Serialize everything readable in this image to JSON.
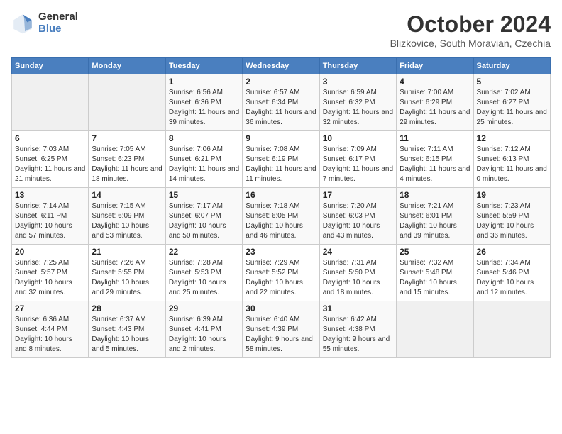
{
  "header": {
    "logo_general": "General",
    "logo_blue": "Blue",
    "month_title": "October 2024",
    "location": "Blizkovice, South Moravian, Czechia"
  },
  "days_of_week": [
    "Sunday",
    "Monday",
    "Tuesday",
    "Wednesday",
    "Thursday",
    "Friday",
    "Saturday"
  ],
  "weeks": [
    [
      {
        "day": "",
        "info": ""
      },
      {
        "day": "",
        "info": ""
      },
      {
        "day": "1",
        "info": "Sunrise: 6:56 AM\nSunset: 6:36 PM\nDaylight: 11 hours and 39 minutes."
      },
      {
        "day": "2",
        "info": "Sunrise: 6:57 AM\nSunset: 6:34 PM\nDaylight: 11 hours and 36 minutes."
      },
      {
        "day": "3",
        "info": "Sunrise: 6:59 AM\nSunset: 6:32 PM\nDaylight: 11 hours and 32 minutes."
      },
      {
        "day": "4",
        "info": "Sunrise: 7:00 AM\nSunset: 6:29 PM\nDaylight: 11 hours and 29 minutes."
      },
      {
        "day": "5",
        "info": "Sunrise: 7:02 AM\nSunset: 6:27 PM\nDaylight: 11 hours and 25 minutes."
      }
    ],
    [
      {
        "day": "6",
        "info": "Sunrise: 7:03 AM\nSunset: 6:25 PM\nDaylight: 11 hours and 21 minutes."
      },
      {
        "day": "7",
        "info": "Sunrise: 7:05 AM\nSunset: 6:23 PM\nDaylight: 11 hours and 18 minutes."
      },
      {
        "day": "8",
        "info": "Sunrise: 7:06 AM\nSunset: 6:21 PM\nDaylight: 11 hours and 14 minutes."
      },
      {
        "day": "9",
        "info": "Sunrise: 7:08 AM\nSunset: 6:19 PM\nDaylight: 11 hours and 11 minutes."
      },
      {
        "day": "10",
        "info": "Sunrise: 7:09 AM\nSunset: 6:17 PM\nDaylight: 11 hours and 7 minutes."
      },
      {
        "day": "11",
        "info": "Sunrise: 7:11 AM\nSunset: 6:15 PM\nDaylight: 11 hours and 4 minutes."
      },
      {
        "day": "12",
        "info": "Sunrise: 7:12 AM\nSunset: 6:13 PM\nDaylight: 11 hours and 0 minutes."
      }
    ],
    [
      {
        "day": "13",
        "info": "Sunrise: 7:14 AM\nSunset: 6:11 PM\nDaylight: 10 hours and 57 minutes."
      },
      {
        "day": "14",
        "info": "Sunrise: 7:15 AM\nSunset: 6:09 PM\nDaylight: 10 hours and 53 minutes."
      },
      {
        "day": "15",
        "info": "Sunrise: 7:17 AM\nSunset: 6:07 PM\nDaylight: 10 hours and 50 minutes."
      },
      {
        "day": "16",
        "info": "Sunrise: 7:18 AM\nSunset: 6:05 PM\nDaylight: 10 hours and 46 minutes."
      },
      {
        "day": "17",
        "info": "Sunrise: 7:20 AM\nSunset: 6:03 PM\nDaylight: 10 hours and 43 minutes."
      },
      {
        "day": "18",
        "info": "Sunrise: 7:21 AM\nSunset: 6:01 PM\nDaylight: 10 hours and 39 minutes."
      },
      {
        "day": "19",
        "info": "Sunrise: 7:23 AM\nSunset: 5:59 PM\nDaylight: 10 hours and 36 minutes."
      }
    ],
    [
      {
        "day": "20",
        "info": "Sunrise: 7:25 AM\nSunset: 5:57 PM\nDaylight: 10 hours and 32 minutes."
      },
      {
        "day": "21",
        "info": "Sunrise: 7:26 AM\nSunset: 5:55 PM\nDaylight: 10 hours and 29 minutes."
      },
      {
        "day": "22",
        "info": "Sunrise: 7:28 AM\nSunset: 5:53 PM\nDaylight: 10 hours and 25 minutes."
      },
      {
        "day": "23",
        "info": "Sunrise: 7:29 AM\nSunset: 5:52 PM\nDaylight: 10 hours and 22 minutes."
      },
      {
        "day": "24",
        "info": "Sunrise: 7:31 AM\nSunset: 5:50 PM\nDaylight: 10 hours and 18 minutes."
      },
      {
        "day": "25",
        "info": "Sunrise: 7:32 AM\nSunset: 5:48 PM\nDaylight: 10 hours and 15 minutes."
      },
      {
        "day": "26",
        "info": "Sunrise: 7:34 AM\nSunset: 5:46 PM\nDaylight: 10 hours and 12 minutes."
      }
    ],
    [
      {
        "day": "27",
        "info": "Sunrise: 6:36 AM\nSunset: 4:44 PM\nDaylight: 10 hours and 8 minutes."
      },
      {
        "day": "28",
        "info": "Sunrise: 6:37 AM\nSunset: 4:43 PM\nDaylight: 10 hours and 5 minutes."
      },
      {
        "day": "29",
        "info": "Sunrise: 6:39 AM\nSunset: 4:41 PM\nDaylight: 10 hours and 2 minutes."
      },
      {
        "day": "30",
        "info": "Sunrise: 6:40 AM\nSunset: 4:39 PM\nDaylight: 9 hours and 58 minutes."
      },
      {
        "day": "31",
        "info": "Sunrise: 6:42 AM\nSunset: 4:38 PM\nDaylight: 9 hours and 55 minutes."
      },
      {
        "day": "",
        "info": ""
      },
      {
        "day": "",
        "info": ""
      }
    ]
  ]
}
